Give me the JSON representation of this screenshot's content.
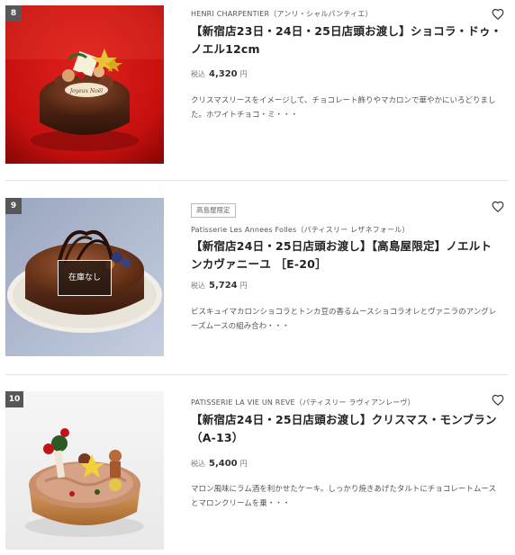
{
  "products": [
    {
      "rank": "8",
      "brand": "HENRI CHARPENTIER（アンリ・シャルパンティエ）",
      "title_line1": "【新宿店23日・24日・25日店頭お渡し】ショコラ・ドゥ・",
      "title_line2": "ノエル12cm",
      "tax_label": "税込",
      "price": "4,320",
      "currency": "円",
      "desc_line1": "クリスマスリースをイメージして、チョコレート飾りやマカロンで華やかにいろどりまし",
      "desc_line2": "た。ホワイトチョコ・ミ・・・",
      "plaque_text": "Joyeux Noël"
    },
    {
      "rank": "9",
      "badge": "高島屋限定",
      "brand": "Patisserie Les Annees Folles（パティスリー レザネフォール）",
      "title_line1": "【新宿店24日・25日店頭お渡し】【高島屋限定】ノエルト",
      "title_line2": "ンカヴァニーユ ［E-20］",
      "tax_label": "税込",
      "price": "5,724",
      "currency": "円",
      "desc_line1": "ビスキュイマカロンショコラとトンカ豆の香るムースショコラオレとヴァニラのアングレ",
      "desc_line2": "ーズムースの組み合わ・・・",
      "soldout": "在庫なし"
    },
    {
      "rank": "10",
      "brand": "PATISSERIE LA VIE UN REVE（パティスリー ラヴィアンレーヴ）",
      "title_line1": "【新宿店24日・25日店頭お渡し】クリスマス・モンブラン",
      "title_line2": "（A-13）",
      "tax_label": "税込",
      "price": "5,400",
      "currency": "円",
      "desc_line1": "マロン風味にラム酒を利かせたケーキ。しっかり焼きあげたタルトにチョコレートムース",
      "desc_line2": "とマロンクリームを乗・・・"
    }
  ],
  "icons": {
    "favorite": "heart-outline-icon"
  },
  "colors": {
    "rank_bg": "#575757",
    "divider": "#e2e2e2",
    "text": "#222222"
  }
}
